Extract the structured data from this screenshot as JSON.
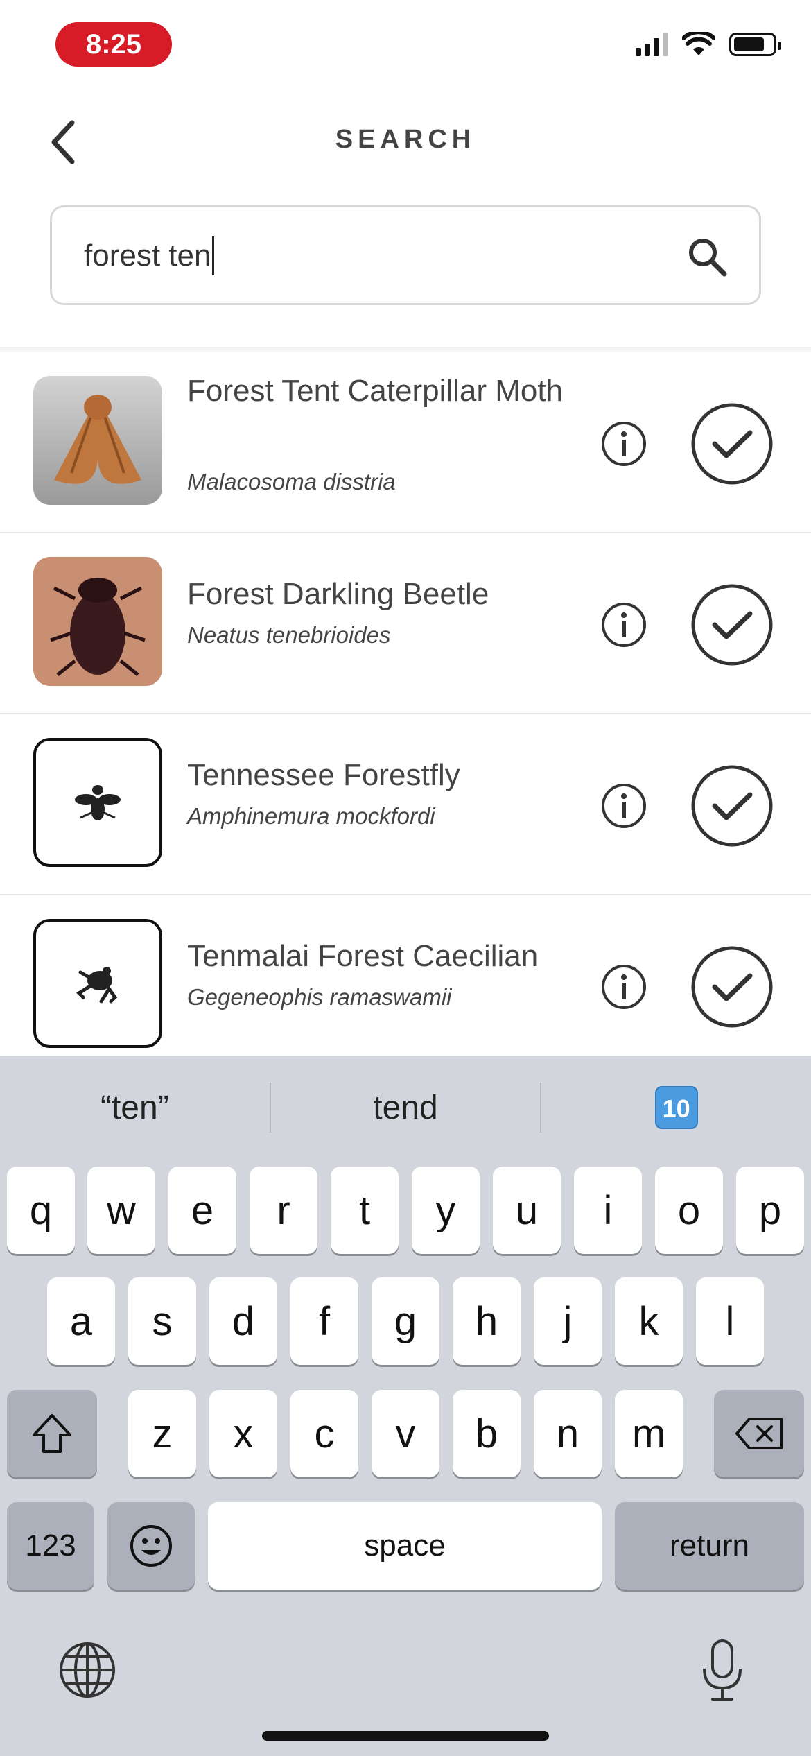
{
  "status_bar": {
    "time": "8:25"
  },
  "header": {
    "title": "SEARCH"
  },
  "search": {
    "value": "forest ten"
  },
  "results": [
    {
      "common_name": "Forest Tent Caterpillar Moth",
      "scientific_name": "Malacosoma disstria",
      "thumb": "moth-photo"
    },
    {
      "common_name": "Forest Darkling Beetle",
      "scientific_name": "Neatus tenebrioides",
      "thumb": "beetle-photo"
    },
    {
      "common_name": "Tennessee Forestfly",
      "scientific_name": "Amphinemura mockfordi",
      "thumb": "insect-icon"
    },
    {
      "common_name": "Tenmalai Forest Caecilian",
      "scientific_name": "Gegeneophis ramaswamii",
      "thumb": "frog-icon"
    }
  ],
  "keyboard": {
    "suggestions": [
      "“ten”",
      "tend",
      "🔟"
    ],
    "row1": [
      "q",
      "w",
      "e",
      "r",
      "t",
      "y",
      "u",
      "i",
      "o",
      "p"
    ],
    "row2": [
      "a",
      "s",
      "d",
      "f",
      "g",
      "h",
      "j",
      "k",
      "l"
    ],
    "row3": [
      "z",
      "x",
      "c",
      "v",
      "b",
      "n",
      "m"
    ],
    "numbers_label": "123",
    "space_label": "space",
    "return_label": "return"
  },
  "colors": {
    "time_pill": "#d81c27",
    "keyboard_bg": "#d2d5db"
  }
}
